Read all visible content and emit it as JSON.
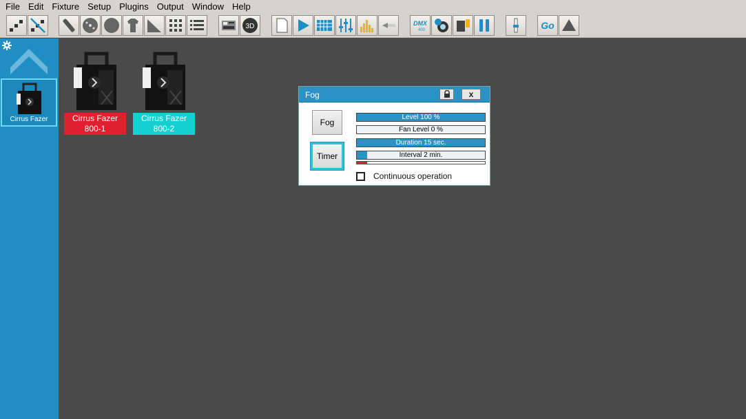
{
  "menu": [
    "File",
    "Edit",
    "Fixture",
    "Setup",
    "Plugins",
    "Output",
    "Window",
    "Help"
  ],
  "toolbar": {
    "dmx_label": "DMX",
    "dmx_sub": "400",
    "go_label": "Go"
  },
  "sidebar": {
    "card_label": "Cirrus Fazer"
  },
  "fixtures": [
    {
      "label": "Cirrus Fazer 800-1",
      "color": "#e0202e"
    },
    {
      "label": "Cirrus Fazer 800-2",
      "color": "#16cfd0"
    }
  ],
  "dialog": {
    "title": "Fog",
    "close_label": "x",
    "fog_button": "Fog",
    "timer_button": "Timer",
    "level": {
      "label": "Level 100 %",
      "value": 100
    },
    "fan_level": {
      "label": "Fan Level 0 %",
      "value": 0
    },
    "duration": {
      "label": "Duration 15 sec.",
      "value": 100
    },
    "interval": {
      "label": "Interval 2 min.",
      "value": 8
    },
    "timer_progress": 8,
    "continuous_label": "Continuous operation",
    "continuous_checked": false
  },
  "colors": {
    "accent": "#2b92c6",
    "sidebar": "#1f8ec2",
    "workspace": "#4a4a4a",
    "fixture_red": "#e0202e",
    "fixture_cyan": "#16cfd0"
  }
}
